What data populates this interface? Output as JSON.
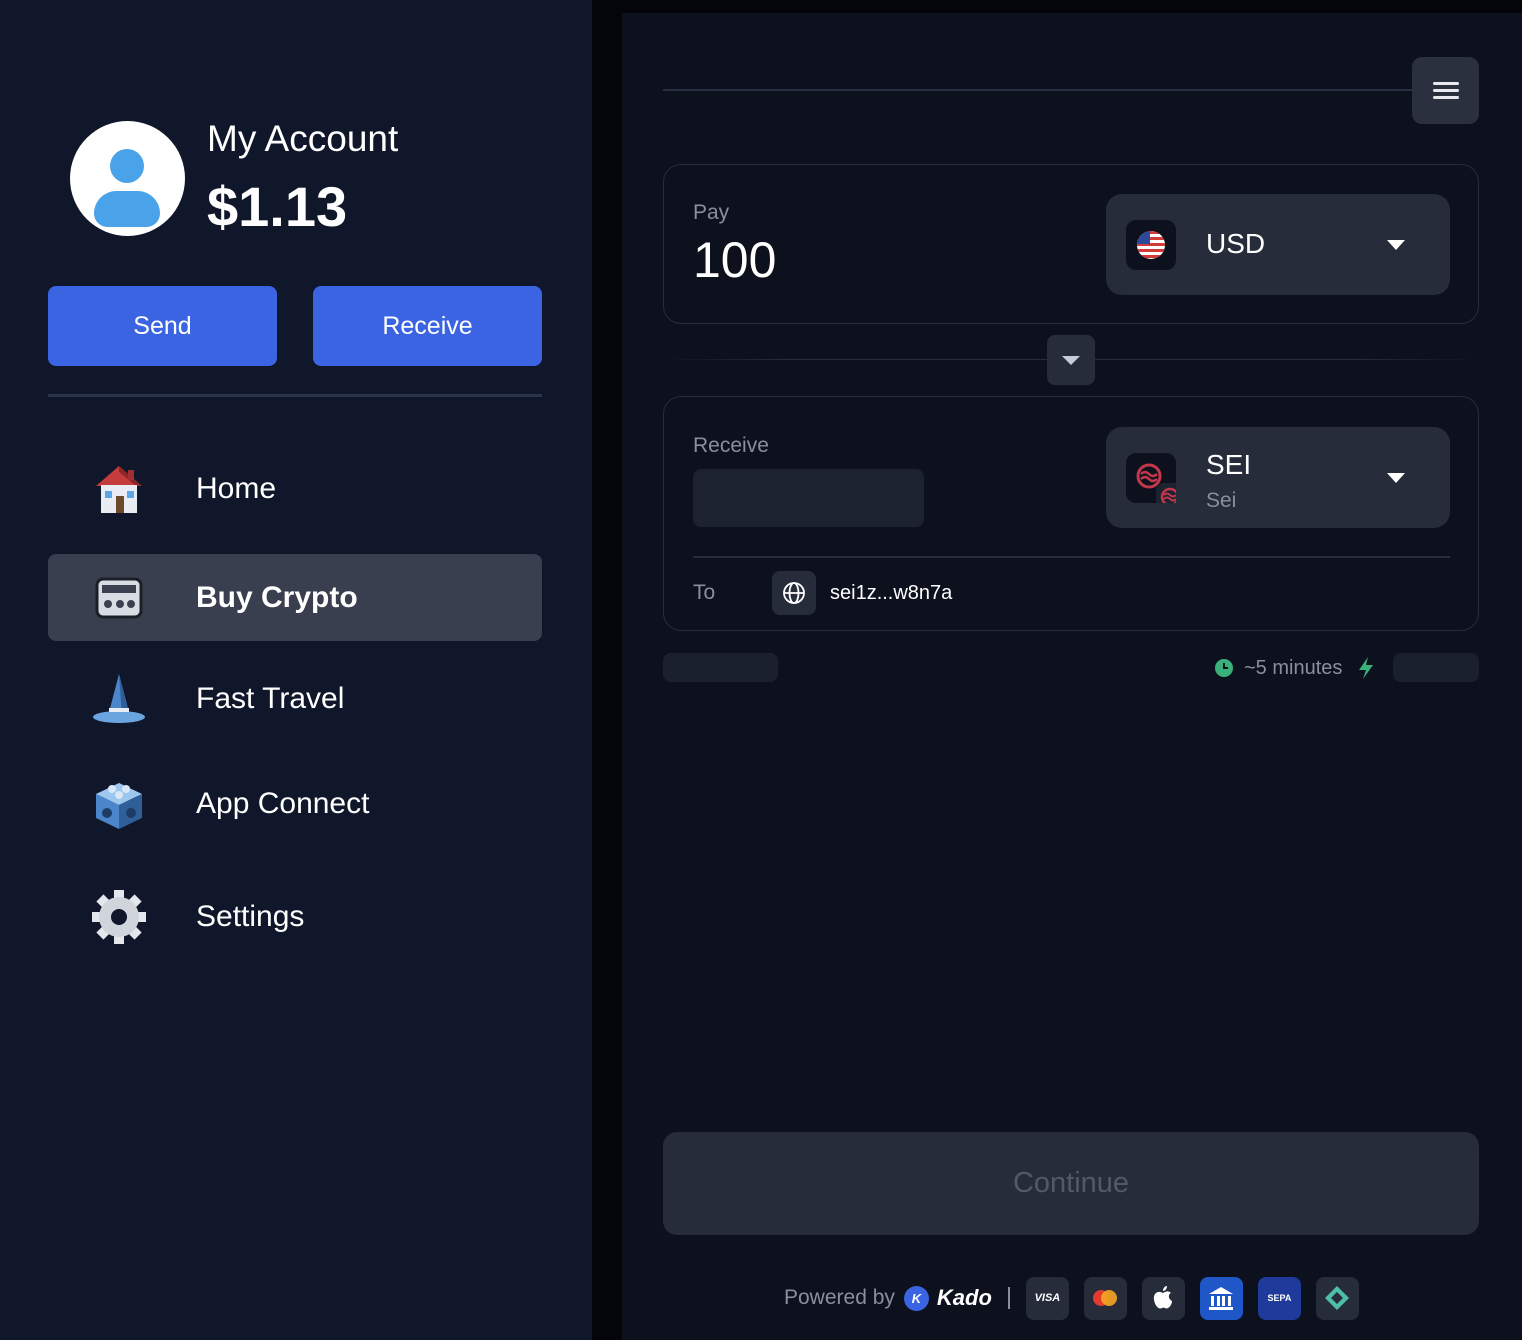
{
  "sidebar": {
    "account_title": "My Account",
    "balance": "$1.13",
    "send_label": "Send",
    "receive_label": "Receive",
    "nav": [
      {
        "label": "Home",
        "icon": "house-icon"
      },
      {
        "label": "Buy Crypto",
        "icon": "crypto-card-icon",
        "active": true
      },
      {
        "label": "Fast Travel",
        "icon": "wizard-hat-icon"
      },
      {
        "label": "App Connect",
        "icon": "blocks-icon"
      },
      {
        "label": "Settings",
        "icon": "gear-icon"
      }
    ]
  },
  "widget": {
    "pay": {
      "label": "Pay",
      "amount": "100",
      "currency_code": "USD",
      "currency_icon": "us-flag-icon"
    },
    "receive": {
      "label": "Receive",
      "amount": "",
      "currency_code": "SEI",
      "currency_name": "Sei",
      "currency_icon": "sei-coin-icon"
    },
    "to": {
      "label": "To",
      "address": "sei1z...w8n7a"
    },
    "eta": "~5 minutes",
    "continue_label": "Continue",
    "footer": {
      "powered_by": "Powered by",
      "brand": "Kado",
      "payment_methods": [
        "VISA",
        "mastercard",
        "apple-pay",
        "bank",
        "SEPA",
        "pix"
      ]
    }
  },
  "colors": {
    "sidebar_bg": "#10172a",
    "widget_bg": "#0c111d",
    "accent_blue": "#3a64e2",
    "eta_green": "#3ab07a"
  }
}
